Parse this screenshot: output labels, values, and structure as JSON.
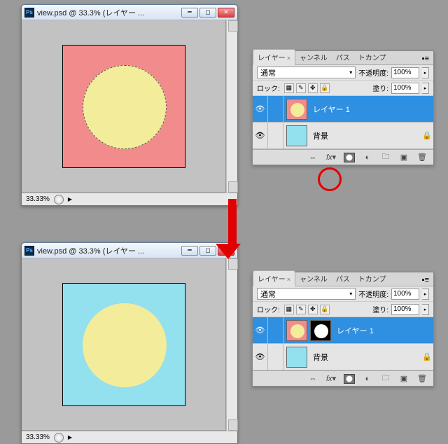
{
  "doc_top": {
    "title": "view.psd @ 33.3% (レイヤー ...",
    "zoom": "33.33%"
  },
  "doc_bottom": {
    "title": "view.psd @ 33.3% (レイヤー ...",
    "zoom": "33.33%"
  },
  "panel": {
    "tabs": {
      "layers": "レイヤー",
      "channels": "ャンネル",
      "paths": "パス",
      "comps": "トカンプ"
    },
    "blend_mode": "通常",
    "opacity_label": "不透明度:",
    "opacity_value": "100%",
    "lock_label": "ロック:",
    "fill_label": "塗り:",
    "fill_value": "100%"
  },
  "panel_top": {
    "layers": [
      {
        "name": "レイヤー 1",
        "selected": true,
        "has_mask": false,
        "locked": false,
        "thumb_bg": "red"
      },
      {
        "name": "背景",
        "selected": false,
        "has_mask": false,
        "locked": true,
        "thumb_bg": "cyan"
      }
    ]
  },
  "panel_bottom": {
    "layers": [
      {
        "name": "レイヤー 1",
        "selected": true,
        "has_mask": true,
        "locked": false,
        "thumb_bg": "red"
      },
      {
        "name": "背景",
        "selected": false,
        "has_mask": false,
        "locked": true,
        "thumb_bg": "cyan"
      }
    ]
  }
}
